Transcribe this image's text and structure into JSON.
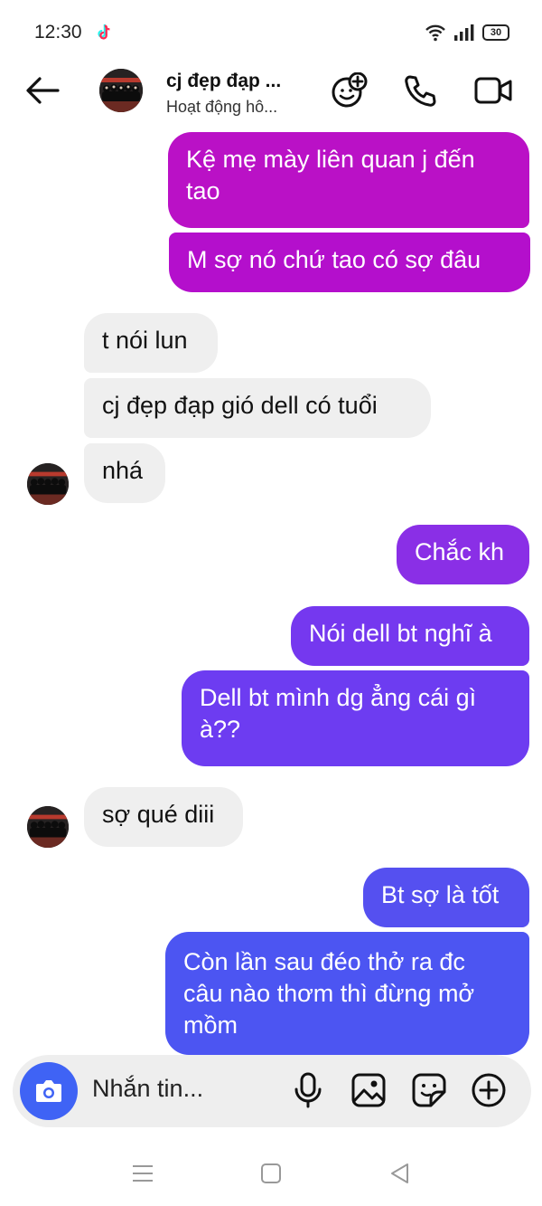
{
  "status_bar": {
    "time": "12:30",
    "battery": "30"
  },
  "header": {
    "contact_name": "cj đẹp đạp ...",
    "contact_status": "Hoạt động hô..."
  },
  "messages": [
    {
      "side": "out",
      "text_lines": [
        "Kệ mẹ mày liên quan j đến",
        "tao"
      ]
    },
    {
      "side": "out",
      "text_lines": [
        "M sợ nó chứ tao có sợ đâu"
      ]
    },
    {
      "side": "in",
      "text_lines": [
        "t nói lun"
      ]
    },
    {
      "side": "in",
      "text_lines": [
        "cj đẹp đạp gió dell có tuổi"
      ]
    },
    {
      "side": "in",
      "text_lines": [
        "nhá"
      ]
    },
    {
      "side": "out",
      "text_lines": [
        "Chắc kh"
      ]
    },
    {
      "side": "out",
      "text_lines": [
        "Nói dell bt nghĩ à"
      ]
    },
    {
      "side": "out",
      "text_lines": [
        "Dell bt mình dg ẳng cái gì",
        "à??"
      ]
    },
    {
      "side": "in",
      "text_lines": [
        "sợ qué diii"
      ]
    },
    {
      "side": "out",
      "text_lines": [
        "Bt sợ là tốt"
      ]
    },
    {
      "side": "out",
      "text_lines": [
        "Còn lần sau đéo thở ra đc",
        "câu nào thơm thì đừng mở",
        "mồm"
      ]
    }
  ],
  "composer": {
    "placeholder": "Nhắn tin..."
  },
  "colors": {
    "gradient_top": "#b80fc9",
    "gradient_mid": "#7c3ff0",
    "gradient_bottom": "#4a56f2",
    "incoming_bg": "#efefef",
    "camera_btn": "#3f63f5"
  },
  "icons": {
    "back": "arrow-left-icon",
    "effects": "smiley-plus-icon",
    "call": "phone-icon",
    "video": "video-camera-icon",
    "camera": "camera-icon",
    "mic": "microphone-icon",
    "gallery": "image-icon",
    "sticker": "sticker-icon",
    "add": "plus-circle-icon"
  }
}
